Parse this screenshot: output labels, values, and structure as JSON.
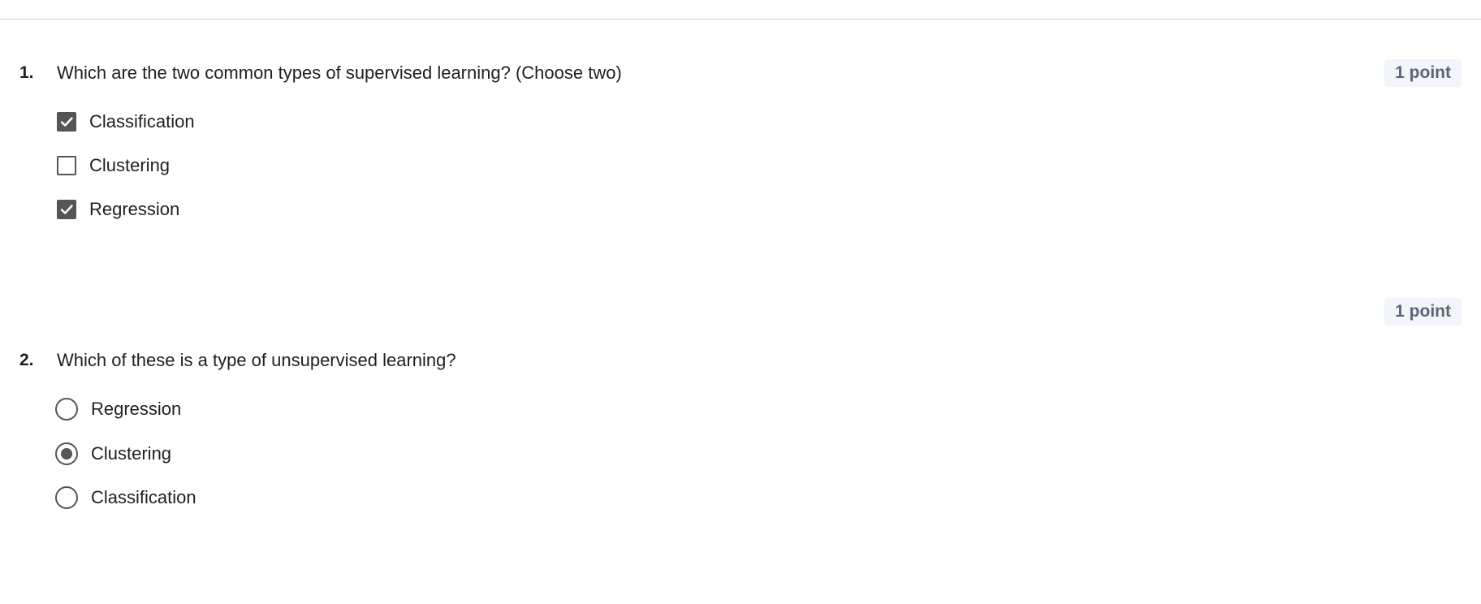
{
  "questions": [
    {
      "number": "1.",
      "text": "Which are the two common types of supervised learning? (Choose two)",
      "points": "1 point",
      "input_type": "checkbox",
      "options": [
        {
          "label": "Classification",
          "checked": true
        },
        {
          "label": "Clustering",
          "checked": false
        },
        {
          "label": "Regression",
          "checked": true
        }
      ]
    },
    {
      "number": "2.",
      "text": "Which of these is a type of unsupervised learning?",
      "points": "1 point",
      "input_type": "radio",
      "options": [
        {
          "label": "Regression",
          "checked": false
        },
        {
          "label": "Clustering",
          "checked": true
        },
        {
          "label": "Classification",
          "checked": false
        }
      ]
    }
  ],
  "colors": {
    "control": "#555555",
    "badge_bg": "#f2f5f9",
    "badge_text": "#5a6678",
    "divider": "#c8c8c8"
  },
  "icons": {
    "checkbox_checked": "checkmark-icon"
  }
}
